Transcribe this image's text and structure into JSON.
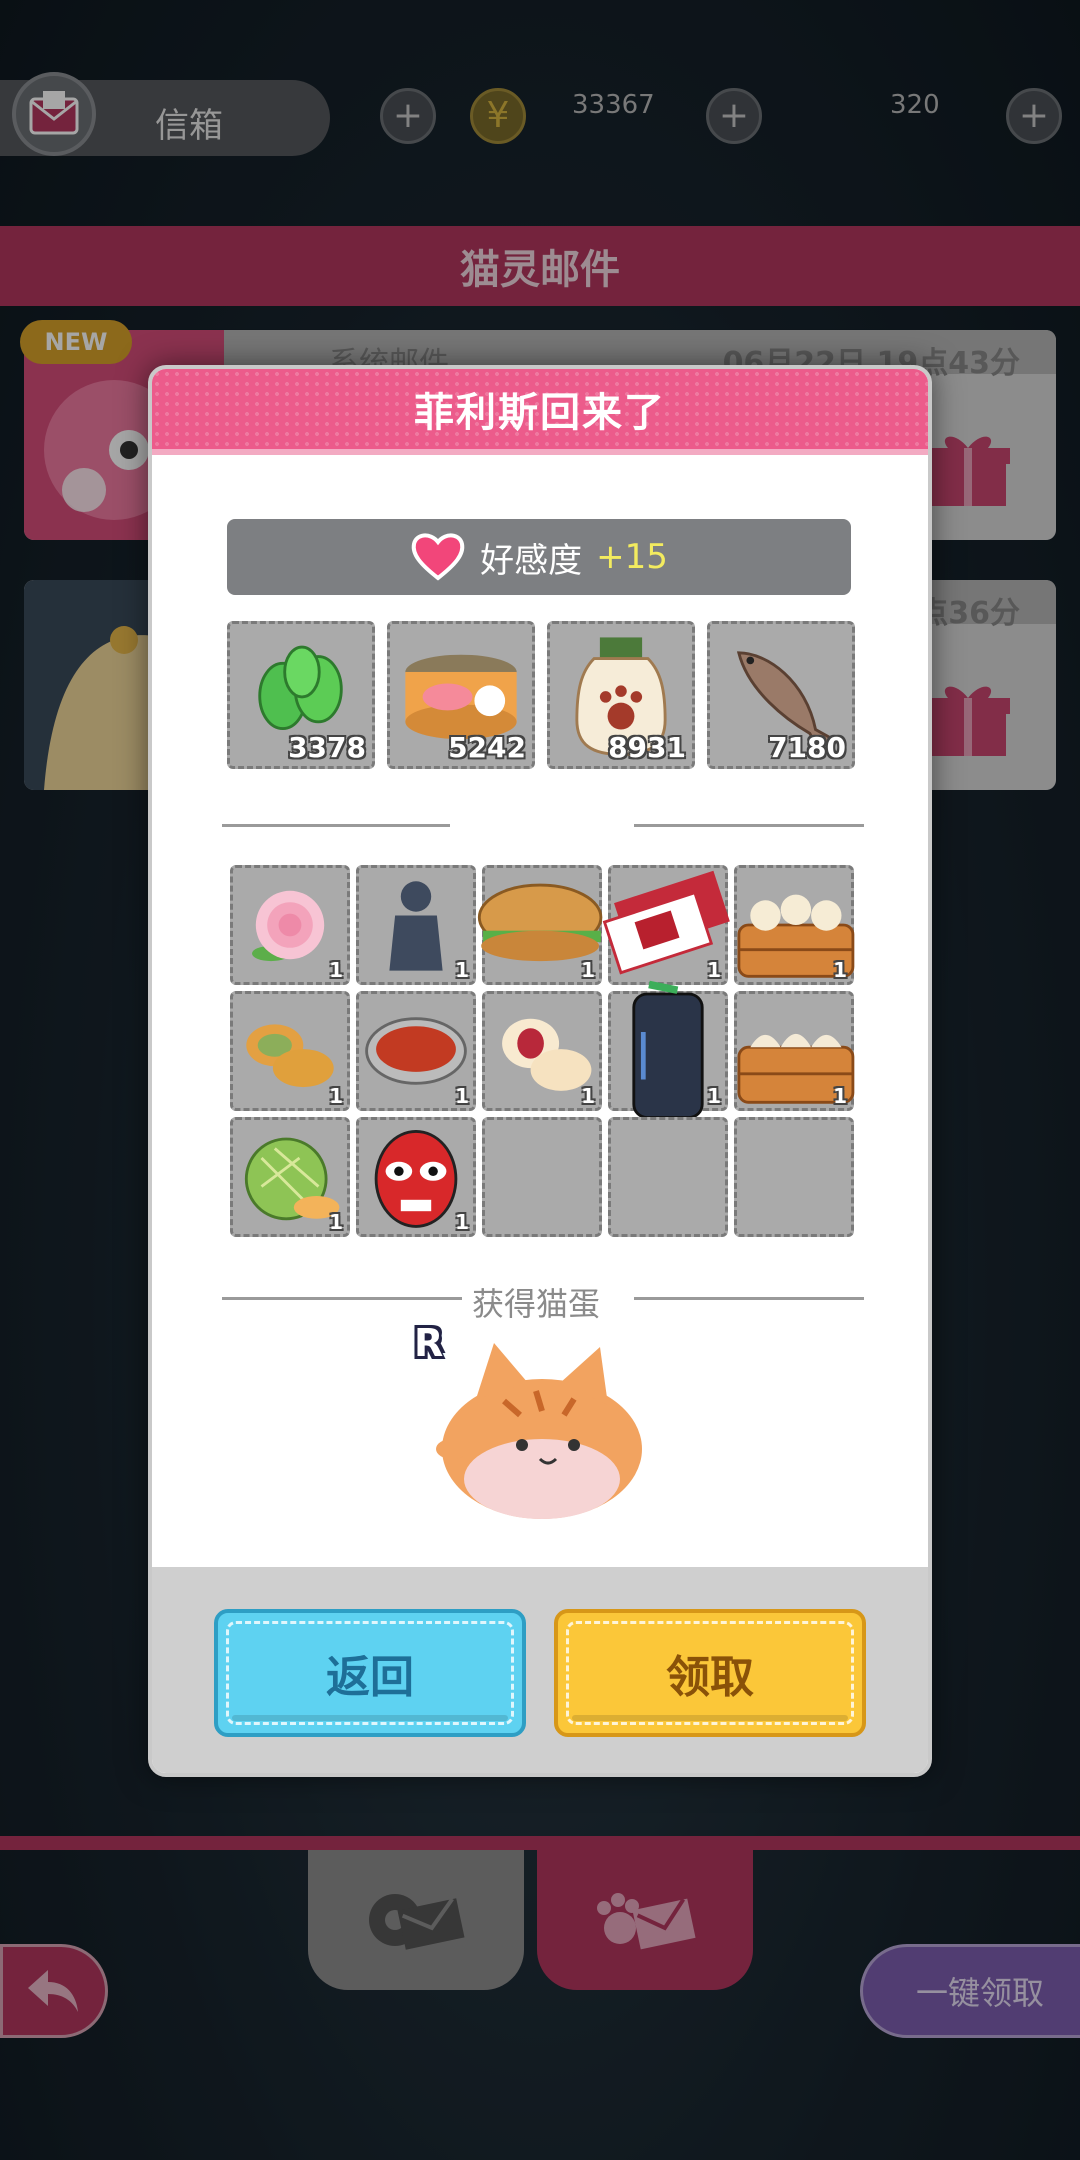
{
  "screen": {
    "mailbox_label": "信箱",
    "header_title": "猫灵邮件",
    "resources": [
      "33367",
      "320"
    ],
    "mails": [
      {
        "badge": "NEW",
        "sender": "系统邮件",
        "date": "06月22日 19点43分"
      },
      {
        "badge": "",
        "sender": "",
        "date": "点36分"
      }
    ],
    "claim_all_label": "一键领取"
  },
  "dialog": {
    "title": "菲利斯回来了",
    "affection_label": "好感度",
    "affection_value": "+15",
    "top_items": [
      {
        "icon": "mint-leaves-icon",
        "count": "3378"
      },
      {
        "icon": "fish-can-icon",
        "count": "5242"
      },
      {
        "icon": "paw-jar-icon",
        "count": "8931"
      },
      {
        "icon": "dried-fish-icon",
        "count": "7180"
      }
    ],
    "gift_items": [
      {
        "icon": "peony-flower-icon",
        "count": "1"
      },
      {
        "icon": "stone-statue-icon",
        "count": "1"
      },
      {
        "icon": "meat-bun-burger-icon",
        "count": "1"
      },
      {
        "icon": "ticket-icon",
        "count": "1"
      },
      {
        "icon": "steamed-buns-basket-icon",
        "count": "1"
      },
      {
        "icon": "mooncake-icon",
        "count": "1"
      },
      {
        "icon": "hotpot-icon",
        "count": "1"
      },
      {
        "icon": "red-bean-pastry-icon",
        "count": "1"
      },
      {
        "icon": "tea-canister-icon",
        "count": "1"
      },
      {
        "icon": "dumplings-basket-icon",
        "count": "1"
      },
      {
        "icon": "melon-icon",
        "count": "1"
      },
      {
        "icon": "opera-mask-icon",
        "count": "1"
      }
    ],
    "egg_section_label": "获得猫蛋",
    "egg_rarity": "R",
    "back_label": "返回",
    "claim_label": "领取"
  },
  "colors": {
    "accent_pink": "#ec5b8b",
    "band_pink": "#b2375f",
    "button_blue": "#5ed2f1",
    "button_yellow": "#fbc739",
    "affection_yellow": "#f3eb5f"
  }
}
